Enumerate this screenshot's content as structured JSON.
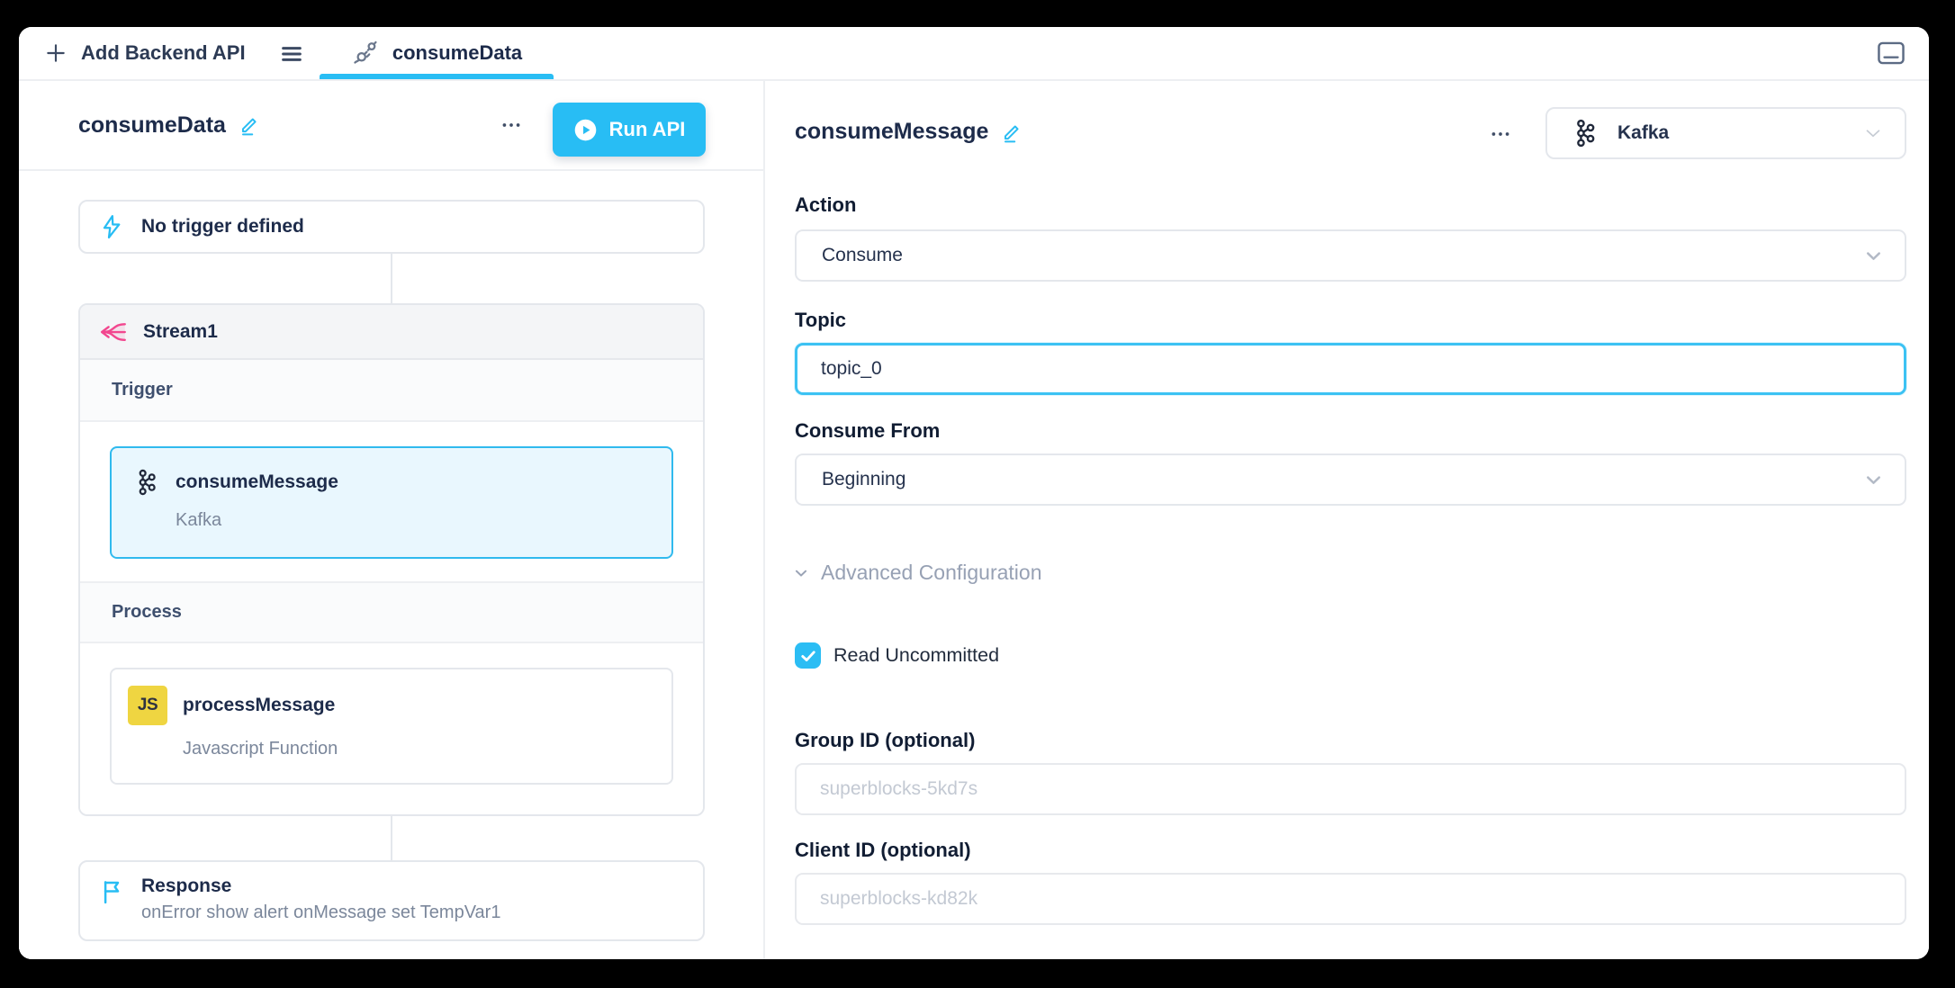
{
  "tab_bar": {
    "add_button": "Add Backend API",
    "active_tab": "consumeData"
  },
  "left_panel": {
    "title": "consumeData",
    "run_button": "Run API",
    "flow": {
      "no_trigger_label": "No trigger defined",
      "stream": {
        "title": "Stream1",
        "trigger_section": "Trigger",
        "process_section": "Process",
        "trigger_step": {
          "name": "consumeMessage",
          "integration": "Kafka"
        },
        "process_step": {
          "name": "processMessage",
          "integration": "Javascript Function",
          "badge": "JS"
        }
      },
      "response": {
        "title": "Response",
        "subtitle": "onError show alert onMessage set TempVar1"
      }
    }
  },
  "right_panel": {
    "title": "consumeMessage",
    "integration_select": "Kafka",
    "action": {
      "label": "Action",
      "value": "Consume"
    },
    "topic": {
      "label": "Topic",
      "value": "topic_0"
    },
    "consume_from": {
      "label": "Consume From",
      "value": "Beginning"
    },
    "advanced_label": "Advanced Configuration",
    "read_uncommitted": {
      "label": "Read Uncommitted",
      "checked": true
    },
    "group_id": {
      "label": "Group ID (optional)",
      "placeholder": "superblocks-5kd7s"
    },
    "client_id": {
      "label": "Client ID (optional)",
      "placeholder": "superblocks-kd82k"
    }
  },
  "colors": {
    "accent": "#28bdf4",
    "selected_card_fill": "#e9f7fe",
    "selected_card_border": "#30baee",
    "stream_pink": "#f2478f",
    "js_yellow": "#efd541"
  }
}
